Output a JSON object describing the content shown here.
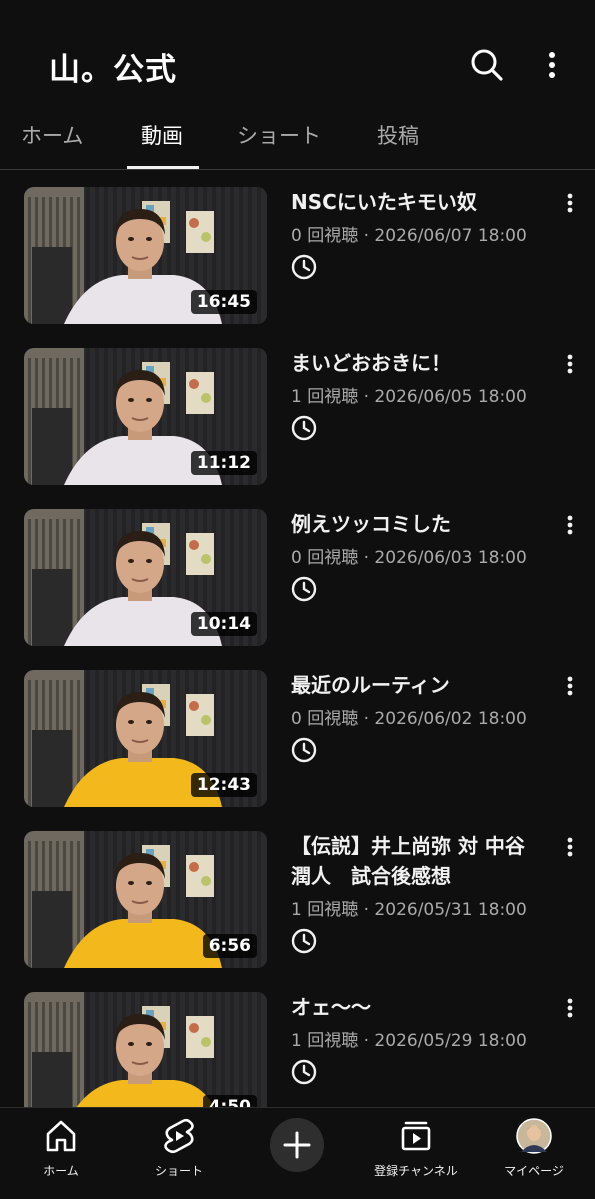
{
  "header": {
    "channel_title": "山。公式",
    "search_icon": "search-icon",
    "more_icon": "more-vert-icon"
  },
  "tabs": [
    {
      "label": "ホーム"
    },
    {
      "label": "動画",
      "active": true
    },
    {
      "label": "ショート"
    },
    {
      "label": "投稿"
    }
  ],
  "videos": [
    {
      "title": "NSCにいたキモい奴",
      "meta": "0 回視聴 · 2026/06/07 18:00",
      "duration": "16:45",
      "shirt": "#e9e3ea"
    },
    {
      "title": "まいどおおきに！",
      "meta": "1 回視聴 · 2026/06/05 18:00",
      "duration": "11:12",
      "shirt": "#e9e3ea"
    },
    {
      "title": "例えツッコミした",
      "meta": "0 回視聴 · 2026/06/03 18:00",
      "duration": "10:14",
      "shirt": "#e9e3ea"
    },
    {
      "title": "最近のルーティン",
      "meta": "0 回視聴 · 2026/06/02 18:00",
      "duration": "12:43",
      "shirt": "#f2b81c"
    },
    {
      "title": "【伝説】井上尚弥 対 中谷潤人　試合後感想",
      "meta": "1 回視聴 · 2026/05/31 18:00",
      "duration": "6:56",
      "shirt": "#f2b81c"
    },
    {
      "title": "オェ〜〜",
      "meta": "1 回視聴 · 2026/05/29 18:00",
      "duration": "4:50",
      "shirt": "#f2b81c"
    }
  ],
  "bottom_nav": {
    "home": "ホーム",
    "shorts": "ショート",
    "create_icon": "plus-icon",
    "subscriptions": "登録チャンネル",
    "you": "マイページ"
  },
  "colors": {
    "background": "#0f0f0f",
    "text_primary": "#f1f1f1",
    "text_secondary": "#aaaaaa"
  }
}
